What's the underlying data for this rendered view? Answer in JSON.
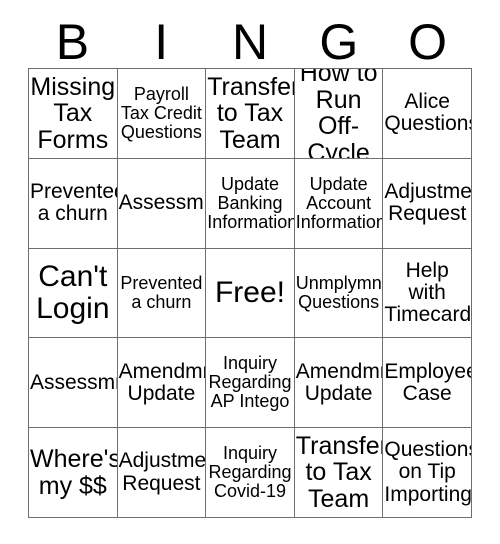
{
  "card": {
    "header_letters": [
      "B",
      "I",
      "N",
      "G",
      "O"
    ],
    "columns": 5,
    "rows": 5,
    "border_color": "#6e6e6e",
    "background_color": "#ffffff",
    "text_color": "#000000",
    "cells": [
      {
        "text": "Missing Tax Forms",
        "size": "lg",
        "free": false
      },
      {
        "text": "Payroll Tax Credit Questions",
        "size": "sm",
        "free": false
      },
      {
        "text": "Transfer to Tax Team",
        "size": "lg",
        "free": false
      },
      {
        "text": "How to Run Off-Cycle",
        "size": "lg",
        "free": false
      },
      {
        "text": "Alice Questions",
        "size": "md",
        "free": false
      },
      {
        "text": "Prevented a churn",
        "size": "md",
        "free": false
      },
      {
        "text": "Assessmnt",
        "size": "md",
        "free": false
      },
      {
        "text": "Update Banking Information",
        "size": "sm",
        "free": false
      },
      {
        "text": "Update Account Information",
        "size": "sm",
        "free": false
      },
      {
        "text": "Adjustment Request",
        "size": "md",
        "free": false
      },
      {
        "text": "Can't Login",
        "size": "xl",
        "free": false
      },
      {
        "text": "Prevented a churn",
        "size": "sm",
        "free": false
      },
      {
        "text": "Free!",
        "size": "xl",
        "free": true
      },
      {
        "text": "Unmplymnt Questions",
        "size": "sm",
        "free": false
      },
      {
        "text": "Help with Timecards",
        "size": "md",
        "free": false
      },
      {
        "text": "Assessmnt",
        "size": "md",
        "free": false
      },
      {
        "text": "Amendmnt Update",
        "size": "md",
        "free": false
      },
      {
        "text": "Inquiry Regarding AP Intego",
        "size": "sm",
        "free": false
      },
      {
        "text": "Amendmnt Update",
        "size": "md",
        "free": false
      },
      {
        "text": "Employee Case",
        "size": "md",
        "free": false
      },
      {
        "text": "Where's my $$",
        "size": "lg",
        "free": false
      },
      {
        "text": "Adjustment Request",
        "size": "md",
        "free": false
      },
      {
        "text": "Inquiry Regarding Covid-19",
        "size": "sm",
        "free": false
      },
      {
        "text": "Transfer to Tax Team",
        "size": "lg",
        "free": false
      },
      {
        "text": "Questions on Tip Importing",
        "size": "md",
        "free": false
      }
    ]
  }
}
